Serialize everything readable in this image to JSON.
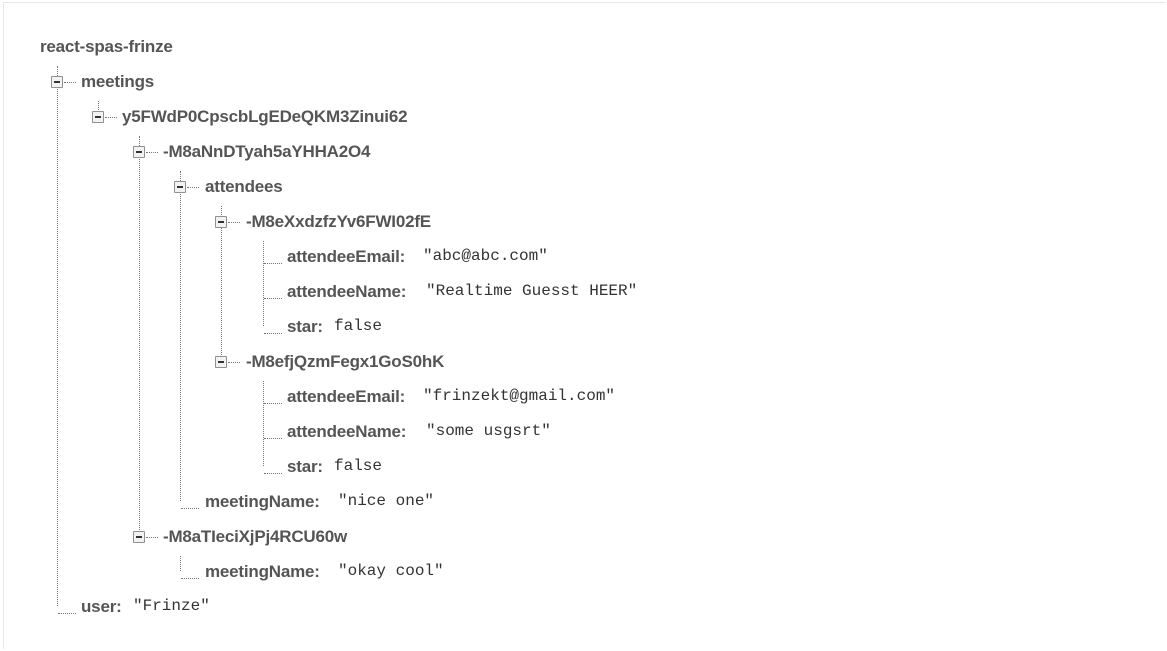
{
  "tree": {
    "root": "react-spas-frinze",
    "meetings_key": "meetings",
    "user_key": "user",
    "user_value": "\"Frinze\"",
    "uid_key": "y5FWdP0CpscbLgEDeQKM3Zinui62",
    "meeting1": {
      "key": "-M8aNnDTyah5aYHHA2O4",
      "attendees_key": "attendees",
      "attendee1": {
        "key": "-M8eXxdzfzYv6FWI02fE",
        "email_key": "attendeeEmail:",
        "email_value": "\"abc@abc.com\"",
        "name_key": "attendeeName:",
        "name_value": "\"Realtime Guesst HEER\"",
        "star_key": "star:",
        "star_value": "false"
      },
      "attendee2": {
        "key": "-M8efjQzmFegx1GoS0hK",
        "email_key": "attendeeEmail:",
        "email_value": "\"frinzekt@gmail.com\"",
        "name_key": "attendeeName:",
        "name_value": "\"some usgsrt\"",
        "star_key": "star:",
        "star_value": "false"
      },
      "meetingName_key": "meetingName:",
      "meetingName_value": "\"nice one\""
    },
    "meeting2": {
      "key": "-M8aTIeciXjPj4RCU60w",
      "meetingName_key": "meetingName:",
      "meetingName_value": "\"okay cool\""
    },
    "user_label": "user:"
  }
}
